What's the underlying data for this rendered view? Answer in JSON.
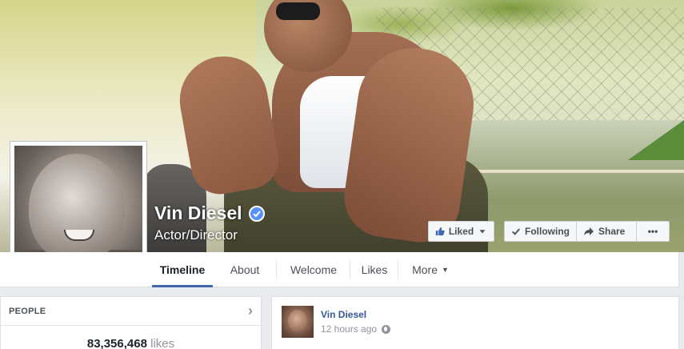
{
  "page": {
    "name": "Vin Diesel",
    "category": "Actor/Director",
    "verified": true
  },
  "actions": {
    "liked_label": "Liked",
    "following_label": "Following",
    "share_label": "Share",
    "more_label": "•••"
  },
  "tabs": [
    {
      "label": "Timeline",
      "active": true
    },
    {
      "label": "About",
      "active": false
    },
    {
      "label": "Welcome",
      "active": false
    },
    {
      "label": "Likes",
      "active": false
    },
    {
      "label": "More",
      "active": false
    }
  ],
  "people": {
    "title": "PEOPLE",
    "likes_count": "83,356,468",
    "likes_word": "likes"
  },
  "post": {
    "author": "Vin Diesel",
    "timestamp": "12 hours ago"
  },
  "colors": {
    "facebook_blue": "#4267b2",
    "link_blue": "#365899",
    "verified_blue": "#5890ff"
  }
}
